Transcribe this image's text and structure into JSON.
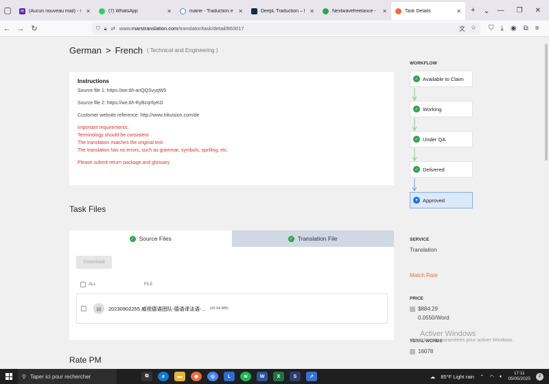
{
  "browser": {
    "tabs": [
      {
        "label": "(Aucun nouveau mail) - son",
        "color": "#6b21a8",
        "active": false
      },
      {
        "label": "(7) WhatsApp",
        "color": "#25d366",
        "active": false
      },
      {
        "label": "mairie - Traduction en angla",
        "color": "#4285f4",
        "active": false
      },
      {
        "label": "DeepL Traduction – DeepL T",
        "color": "#0f2b46",
        "active": false
      },
      {
        "label": "Nextwavefreelance - Compl",
        "color": "#2ea44f",
        "active": false
      },
      {
        "label": "Task Details",
        "color": "#f06a3d",
        "active": true
      }
    ],
    "url_prefix": "www.",
    "url_host": "marstranslation.com",
    "url_path": "/translator/task/detail/863017"
  },
  "header": {
    "source_lang": "German",
    "separator": ">",
    "target_lang": "French",
    "category": "( Technical and Engineering )"
  },
  "instructions": {
    "title": "Instructions",
    "source_file_1": "Source file 1: https://we.tl/t-anQQSvyqW5",
    "source_file_2": "Source file 2: https://we.tl/t-RyBcqr6yKG",
    "website": "Customer website reference: http://www.hikvision.com/de",
    "requirements": [
      "Important requirements:",
      "Terminology should be consistent",
      "The translation matches the original text.",
      "The translation has no errors, such as grammar, symbols, spelling, etc."
    ],
    "footer_note": "Please submit return package and glossary"
  },
  "task_files": {
    "title": "Task Files",
    "tab_source": "Source Files",
    "tab_translation": "Translation File",
    "download_label": "Download",
    "col_all": "ALL",
    "col_file": "FILE",
    "file_name": "20230902255 威视德语团队-德语译法语-...",
    "file_size": "(42.64 MB)"
  },
  "rate_pm": {
    "title": "Rate PM"
  },
  "workflow": {
    "title": "WORKFLOW",
    "steps": [
      {
        "label": "Available to Claim",
        "current": false
      },
      {
        "label": "Working",
        "current": false
      },
      {
        "label": "Under QA",
        "current": false
      },
      {
        "label": "Delivered",
        "current": false
      },
      {
        "label": "Approved",
        "current": true
      }
    ]
  },
  "details": {
    "service_label": "SERVICE",
    "service_value": "Translation",
    "match_rate_label": "Match Rate",
    "price_label": "PRICE",
    "price_total": "$884.29",
    "price_unit": "0.0550/Word",
    "total_words_label": "TOTAL WORDS",
    "total_words_value": "16078"
  },
  "watermark": {
    "line1": "Activer Windows",
    "line2": "Accédez aux paramètres pour activer Windows."
  },
  "taskbar": {
    "search_placeholder": "Taper ici pour rechercher",
    "weather": "85°F  Light rain",
    "time": "17:11",
    "date": "05/05/2025",
    "notifications": "2"
  }
}
